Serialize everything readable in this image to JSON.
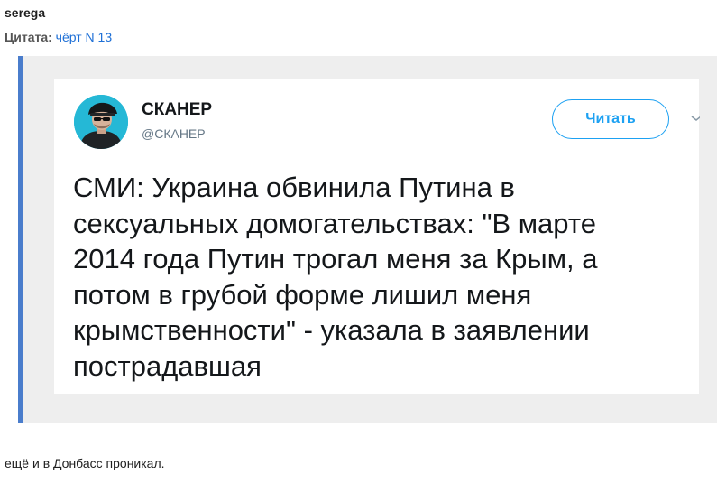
{
  "post": {
    "author": "serega",
    "quote_label": "Цитата:",
    "quote_author": "чёрт N 13",
    "body_text": "ещё и в Донбасс проникал."
  },
  "tweet": {
    "display_name": "СКАНЕР",
    "handle": "@СКАНЕР",
    "follow_label": "Читать",
    "text": "СМИ: Украина обвинила Путина в\nсексуальных домогательствах: \"В марте\n2014 года Путин трогал меня за Крым, а\nпотом в грубой форме лишил меня\nкрымственности\" - указала в заявлении\nпострадавшая",
    "chevron_icon": "chevron-down-icon",
    "avatar_icon": "avatar"
  },
  "colors": {
    "quote_border": "#4a7dcc",
    "quote_bg": "#eeeeee",
    "link": "#1d6fd6",
    "twitter_blue": "#1da1f2",
    "avatar_bg": "#25b8d6"
  }
}
